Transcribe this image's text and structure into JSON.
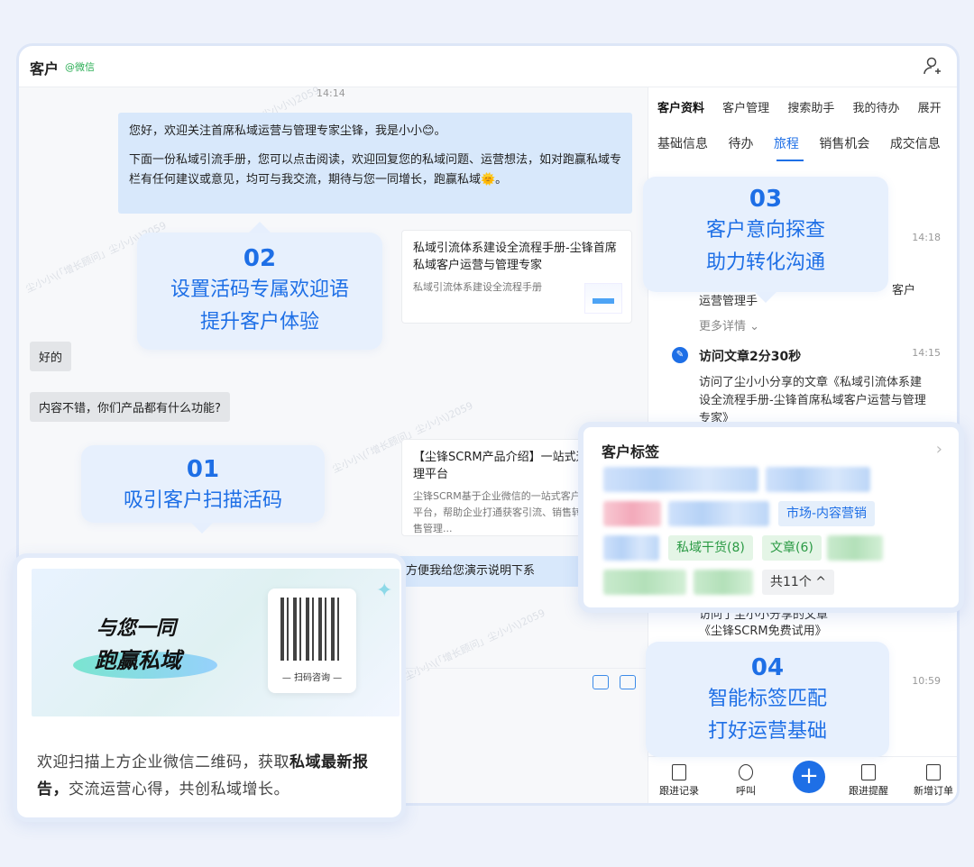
{
  "window": {
    "title": "客户",
    "source_tag": "@微信"
  },
  "chat": {
    "timestamp": "14:14",
    "welcome_line1": "您好，欢迎关注首席私域运营与管理专家尘锋，我是小小😊。",
    "welcome_line2": "下面一份私域引流手册，您可以点击阅读，欢迎回复您的私域问题、运营想法，如对跑赢私域专栏有任何建议或意见，均可与我交流，期待与您一同增长，跑赢私域🌞。",
    "card1": {
      "title": "私域引流体系建设全流程手册-尘锋首席私域客户运营与管理专家",
      "desc": "私域引流体系建设全流程手册"
    },
    "reply1": "好的",
    "reply2": "内容不错，你们产品都有什么功能?",
    "card2": {
      "title": "【尘锋SCRM产品介绍】一站式运营管理平台",
      "desc": "尘锋SCRM基于企业微信的一站式客户运营管理平台，帮助企业打通获客引流、销售转化、销售管理..."
    },
    "msg_partial": "这是我们的产品介绍，您可以先看看，如果方便我给您演示说明下系",
    "watermark": "尘小小\\(「增长顾问」尘小小\\)2059"
  },
  "panel": {
    "tabs1": [
      "客户资料",
      "客户管理",
      "搜索助手",
      "我的待办",
      "展开"
    ],
    "tabs2": [
      "基础信息",
      "待办",
      "旅程",
      "销售机会",
      "成交信息"
    ],
    "timeline": [
      {
        "time": "14:18",
        "text": "运营管理手",
        "text_tail": "客户",
        "more": "更多详情"
      },
      {
        "time": "14:15",
        "head": "访问文章2分30秒",
        "text": "访问了尘小小分享的文章《私域引流体系建设全流程手册-尘锋首席私域客户运营与管理专家》"
      },
      {
        "time": "",
        "text_a": "访问了尘小小分享的文章",
        "text_b": "《尘锋SCRM免费试用》"
      },
      {
        "time": "10:59"
      }
    ],
    "bottom": [
      "跟进记录",
      "呼叫",
      "+",
      "跟进提醒",
      "新增订单"
    ]
  },
  "callouts": [
    {
      "num": "01",
      "line1": "吸引客户扫描活码",
      "line2": ""
    },
    {
      "num": "02",
      "line1": "设置活码专属欢迎语",
      "line2": "提升客户体验"
    },
    {
      "num": "03",
      "line1": "客户意向探查",
      "line2": "助力转化沟通"
    },
    {
      "num": "04",
      "line1": "智能标签匹配",
      "line2": "打好运营基础"
    }
  ],
  "tag_card": {
    "title": "客户标签",
    "tags": [
      "市场-内容营销",
      "私域干货(8)",
      "文章(6)",
      "共11个 ^"
    ]
  },
  "promo": {
    "slogan1": "与您一同",
    "slogan2": "跑赢私域",
    "qr_label": "— 扫码咨询 —",
    "desc_a": "欢迎扫描上方企业微信二维码，获取",
    "desc_b": "私域最新报告，",
    "desc_c": "交流运营心得，共创私域增长。"
  },
  "colors": {
    "accent": "#1e6fe6",
    "wechat_green": "#2bae55",
    "bubble": "#d8e8fb",
    "callout_bg": "#e6effd"
  }
}
